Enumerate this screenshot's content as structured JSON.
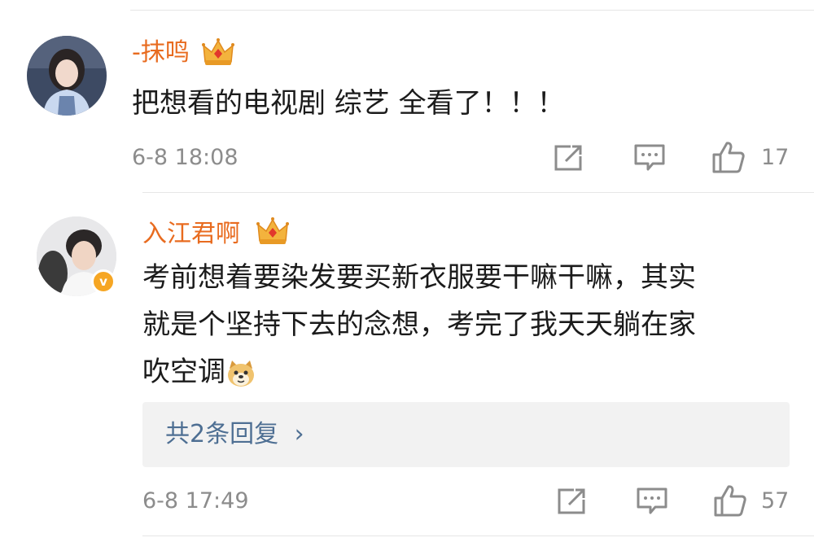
{
  "comments": [
    {
      "username": "-抹鸣",
      "text": "把想看的电视剧 综艺 全看了！！！",
      "timestamp": "6-8 18:08",
      "likes": "17",
      "badge_icon": "crown-badge-icon",
      "verified": false
    },
    {
      "username": "入江君啊",
      "text_lines": [
        "考前想着要染发要买新衣服要干嘛干嘛，其实",
        "就是个坚持下去的念想，考完了我天天躺在家",
        "吹空调"
      ],
      "emoji_icon": "doge-emoji-icon",
      "timestamp": "6-8 17:49",
      "likes": "57",
      "badge_icon": "crown-badge-icon",
      "verified": true,
      "verified_mark": "v",
      "replies_label": "共2条回复",
      "replies_chevron": "›"
    }
  ],
  "colors": {
    "username": "#e86b1f",
    "link": "#4e6f93",
    "meta": "#8c8c8c",
    "verified": "#f6a623"
  }
}
